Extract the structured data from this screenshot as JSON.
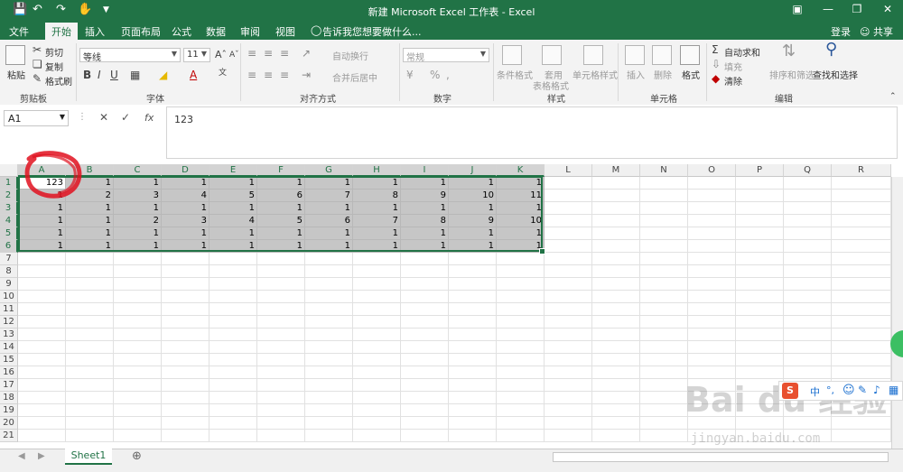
{
  "window": {
    "title": "新建 Microsoft Excel 工作表 - Excel",
    "save_icon": "save-icon",
    "undo_icon": "undo-icon",
    "redo_icon": "redo-icon",
    "touch_icon": "touch-mode-icon"
  },
  "tabs": [
    "文件",
    "开始",
    "插入",
    "页面布局",
    "公式",
    "数据",
    "审阅",
    "视图"
  ],
  "active_tab": "开始",
  "tell_me": "告诉我您想要做什么...",
  "account": {
    "login": "登录",
    "share": "共享"
  },
  "ribbon": {
    "clipboard": {
      "paste": "粘贴",
      "cut": "剪切",
      "copy": "复制",
      "format_painter": "格式刷",
      "label": "剪贴板"
    },
    "font": {
      "name": "等线",
      "size": "11",
      "bold": "B",
      "italic": "I",
      "underline": "U",
      "font_color": "A",
      "label": "字体"
    },
    "alignment": {
      "wrap": "自动换行",
      "merge": "合并后居中",
      "label": "对齐方式"
    },
    "number": {
      "format": "常规",
      "percent": "%",
      "comma": ",",
      "label": "数字"
    },
    "styles": {
      "conditional": "条件格式",
      "table_line1": "套用",
      "table_line2": "表格格式",
      "cell_styles": "单元格样式",
      "label": "样式"
    },
    "cells": {
      "insert": "插入",
      "delete": "删除",
      "format": "格式",
      "label": "单元格"
    },
    "editing": {
      "autosum": "自动求和",
      "fill": "填充",
      "clear": "清除",
      "sort": "排序和筛选",
      "find": "查找和选择",
      "label": "编辑"
    }
  },
  "formula_bar": {
    "name_box": "A1",
    "fx": "fx",
    "value": "123"
  },
  "columns": [
    "A",
    "B",
    "C",
    "D",
    "E",
    "F",
    "G",
    "H",
    "I",
    "J",
    "K",
    "L",
    "M",
    "N",
    "O",
    "P",
    "Q",
    "R"
  ],
  "rows": [
    [
      "123",
      "1",
      "1",
      "1",
      "1",
      "1",
      "1",
      "1",
      "1",
      "1",
      "1"
    ],
    [
      "1",
      "2",
      "3",
      "4",
      "5",
      "6",
      "7",
      "8",
      "9",
      "10",
      "11"
    ],
    [
      "1",
      "1",
      "1",
      "1",
      "1",
      "1",
      "1",
      "1",
      "1",
      "1",
      "1"
    ],
    [
      "1",
      "1",
      "2",
      "3",
      "4",
      "5",
      "6",
      "7",
      "8",
      "9",
      "10"
    ],
    [
      "1",
      "1",
      "1",
      "1",
      "1",
      "1",
      "1",
      "1",
      "1",
      "1",
      "1"
    ],
    [
      "1",
      "1",
      "1",
      "1",
      "1",
      "1",
      "1",
      "1",
      "1",
      "1",
      "1"
    ]
  ],
  "row_count": 22,
  "sheet": {
    "name": "Sheet1"
  },
  "ime": {
    "lang": "中",
    "punct": "°,"
  },
  "watermark": {
    "main": "Bai du 经验",
    "sub": "jingyan.baidu.com"
  },
  "colors": {
    "accent": "#217346",
    "selection": "#c6c6c6"
  }
}
